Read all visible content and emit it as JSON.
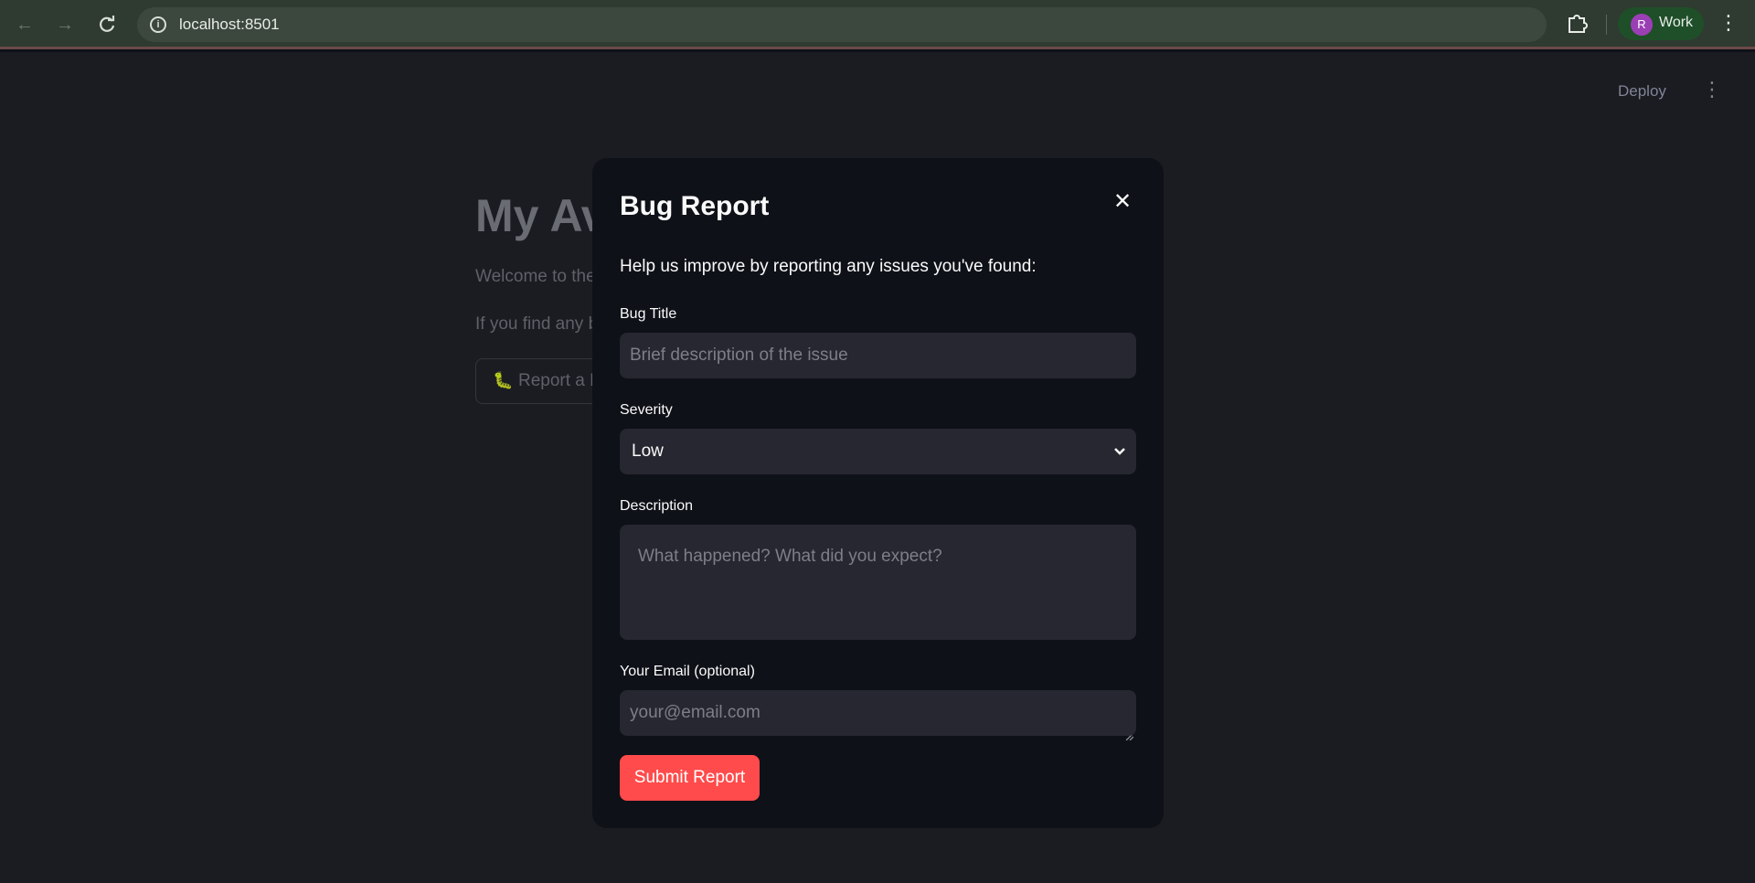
{
  "browser": {
    "url": "localhost:8501",
    "profile_initial": "R",
    "profile_name": "Work"
  },
  "app": {
    "deploy_label": "Deploy",
    "title_partial": "My Av",
    "welcome_partial": "Welcome to the",
    "find_partial": "If you find any b",
    "report_button_partial": "Report a B",
    "report_button_icon": "caterpillar-icon"
  },
  "modal": {
    "title": "Bug Report",
    "intro": "Help us improve by reporting any issues you've found:",
    "bug_title": {
      "label": "Bug Title",
      "value": "",
      "placeholder": "Brief description of the issue"
    },
    "severity": {
      "label": "Severity",
      "value": "Low"
    },
    "description": {
      "label": "Description",
      "value": "",
      "placeholder": "What happened? What did you expect?"
    },
    "email": {
      "label": "Your Email (optional)",
      "value": "",
      "placeholder": "your@email.com"
    },
    "submit_label": "Submit Report"
  },
  "colors": {
    "accent": "#ff4b4b",
    "modal_background": "#0f1118",
    "input_background": "#262730",
    "browser_bar": "#2f3a30"
  }
}
